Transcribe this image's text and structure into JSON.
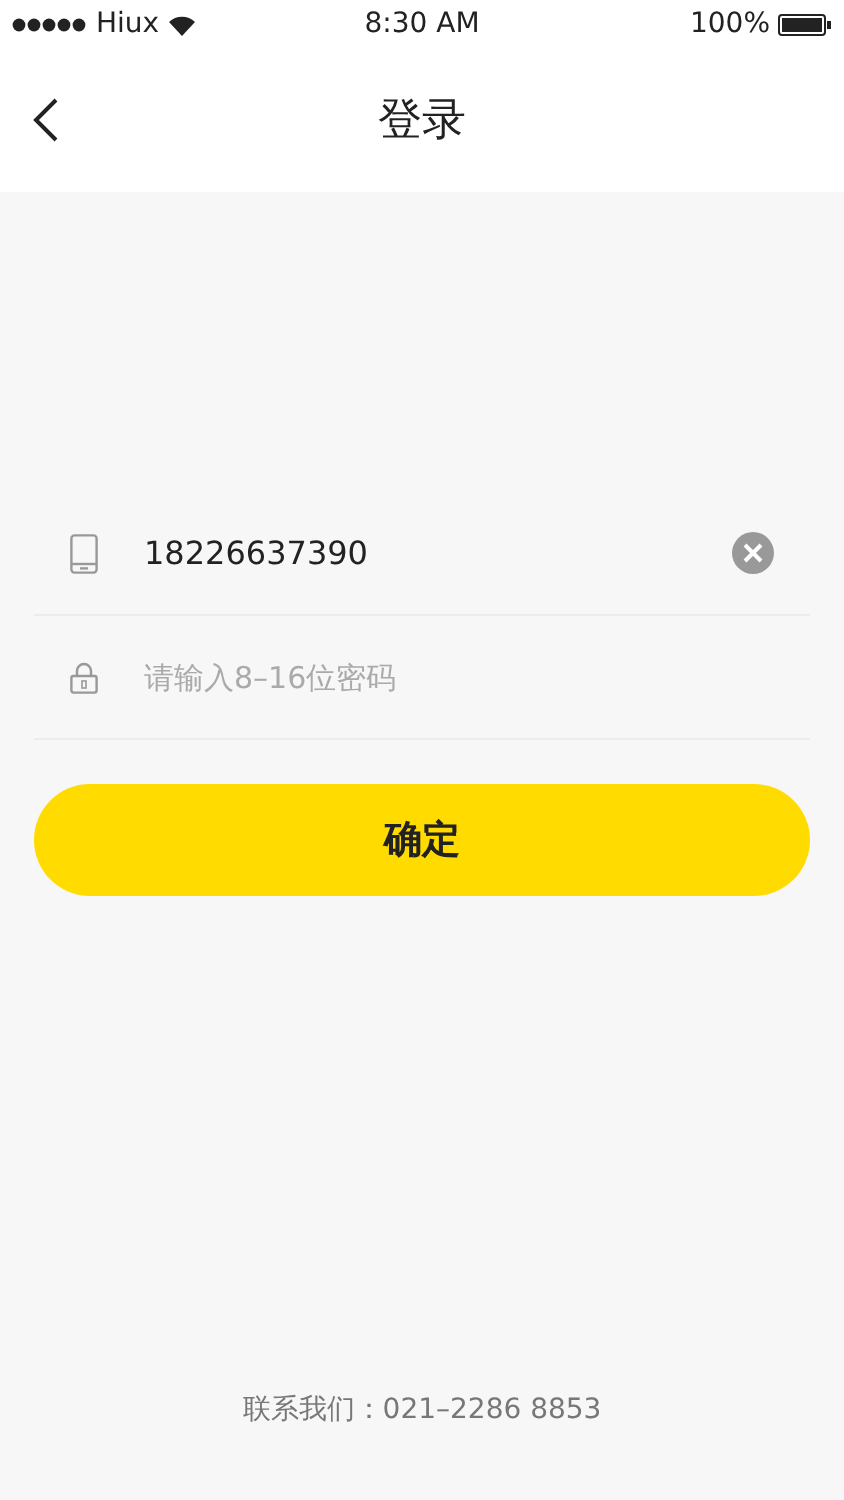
{
  "status_bar": {
    "carrier": "Hiux",
    "time": "8:30 AM",
    "battery": "100%"
  },
  "nav": {
    "title": "登录"
  },
  "form": {
    "phone": {
      "value": "18226637390"
    },
    "password": {
      "placeholder": "请输入8–16位密码"
    },
    "submit": "确定"
  },
  "footer": {
    "contact": "联系我们：021–2286 8853"
  }
}
